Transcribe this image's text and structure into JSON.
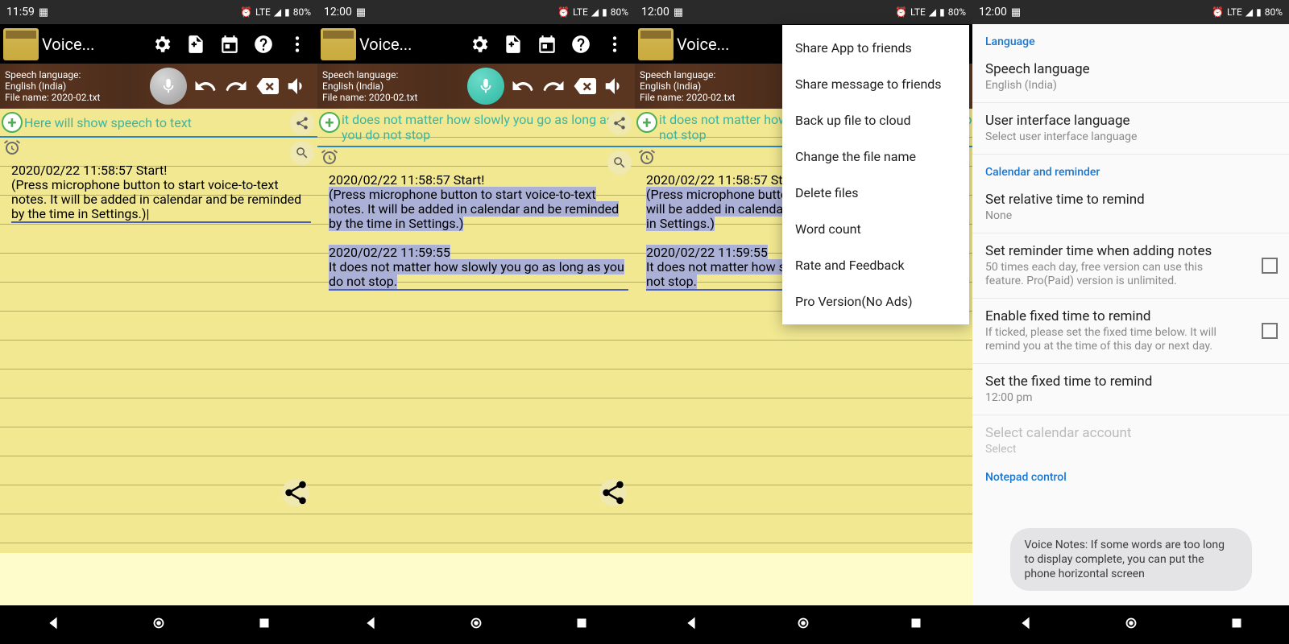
{
  "statusbar": {
    "times": [
      "11:59",
      "12:00",
      "12:00",
      "12:00"
    ],
    "network": "LTE",
    "battery": "80%"
  },
  "app": {
    "title": "Voice..."
  },
  "toolbar_info": {
    "line1": "Speech language:",
    "line2": "English (India)",
    "line3": "File name: 2020-02.txt"
  },
  "input": {
    "placeholder": "Here will show speech to text",
    "active_text": "it does not matter how slowly you go as long as you do not stop"
  },
  "notes": {
    "entry1_time": "2020/02/22 11:58:57 Start!",
    "entry1_body": "(Press microphone button to start voice-to-text notes. It will be added in calendar and be reminded by the time in Settings.)",
    "entry2_time": "2020/02/22 11:59:55",
    "entry2_body": "It does not matter how slowly you go as long as you do not stop."
  },
  "menu": {
    "items": [
      "Share App to friends",
      "Share message to friends",
      "Back up file to cloud",
      "Change the file name",
      "Delete files",
      "Word count",
      "Rate and Feedback",
      "Pro Version(No Ads)"
    ]
  },
  "settings": {
    "sec_language": "Language",
    "speech_lang_t": "Speech language",
    "speech_lang_s": "English (India)",
    "ui_lang_t": "User interface language",
    "ui_lang_s": "Select user interface language",
    "sec_calendar": "Calendar and reminder",
    "rel_time_t": "Set relative time to remind",
    "rel_time_s": "None",
    "rem_add_t": "Set reminder time when adding notes",
    "rem_add_s": "50 times each day, free version can use this feature. Pro(Paid) version is unlimited.",
    "fixed_en_t": "Enable fixed time to remind",
    "fixed_en_s": "If ticked, please set the fixed time below. It will remind you at the time of this day or next day.",
    "fixed_set_t": "Set the fixed time to remind",
    "fixed_set_s": "12:00 pm",
    "cal_acc_t": "Select calendar account",
    "cal_acc_s": "Select",
    "sec_notepad": "Notepad control"
  },
  "toast": "Voice Notes: If some words are too long to display complete, you can put the phone horizontal screen"
}
